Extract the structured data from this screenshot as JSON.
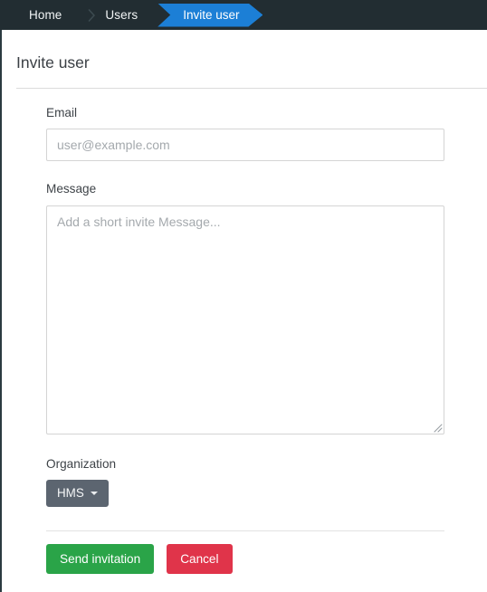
{
  "colors": {
    "topbar_bg": "#222d32",
    "accent_blue": "#1c7fd6",
    "success_green": "#2aa448",
    "danger_red": "#e0344a",
    "dropdown_grey": "#5c6570"
  },
  "breadcrumb": {
    "items": [
      {
        "label": "Home",
        "active": false
      },
      {
        "label": "Users",
        "active": false
      },
      {
        "label": "Invite user",
        "active": true
      }
    ],
    "separator_icon": "chevron-right-icon"
  },
  "page": {
    "title": "Invite user"
  },
  "form": {
    "email": {
      "label": "Email",
      "value": "",
      "placeholder": "user@example.com"
    },
    "message": {
      "label": "Message",
      "value": "",
      "placeholder": "Add a short invite Message...",
      "resize_handle_icon": "resize-grip-icon"
    },
    "organization": {
      "label": "Organization",
      "selected": "HMS",
      "caret_icon": "caret-down-icon"
    }
  },
  "actions": {
    "submit_label": "Send invitation",
    "cancel_label": "Cancel"
  }
}
